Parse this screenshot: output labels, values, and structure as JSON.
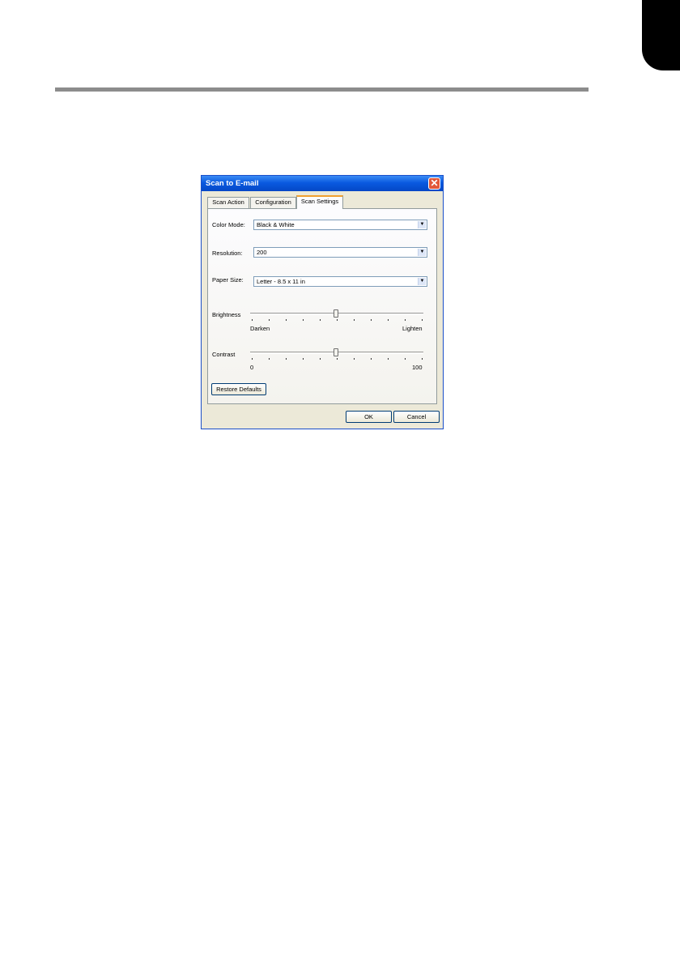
{
  "dialog": {
    "title": "Scan to E-mail",
    "close_glyph": "✕",
    "tabs": [
      {
        "label": "Scan Action"
      },
      {
        "label": "Configuration"
      },
      {
        "label": "Scan Settings"
      }
    ],
    "active_tab": "Scan Settings",
    "color_mode": {
      "label": "Color Mode:",
      "value": "Black & White"
    },
    "resolution": {
      "label": "Resolution:",
      "value": "200"
    },
    "paper_size": {
      "label": "Paper Size:",
      "value": "Letter - 8.5 x 11 in"
    },
    "brightness": {
      "label": "Brightness",
      "min_label": "Darken",
      "max_label": "Lighten",
      "level": 0.5
    },
    "contrast": {
      "label": "Contrast",
      "min_label": "0",
      "max_label": "100",
      "level": 0.5
    },
    "restore_defaults_label": "Restore Defaults",
    "ok_label": "OK",
    "cancel_label": "Cancel",
    "dropdown_glyph": "▼",
    "accent_color": "#0a5ae0"
  }
}
